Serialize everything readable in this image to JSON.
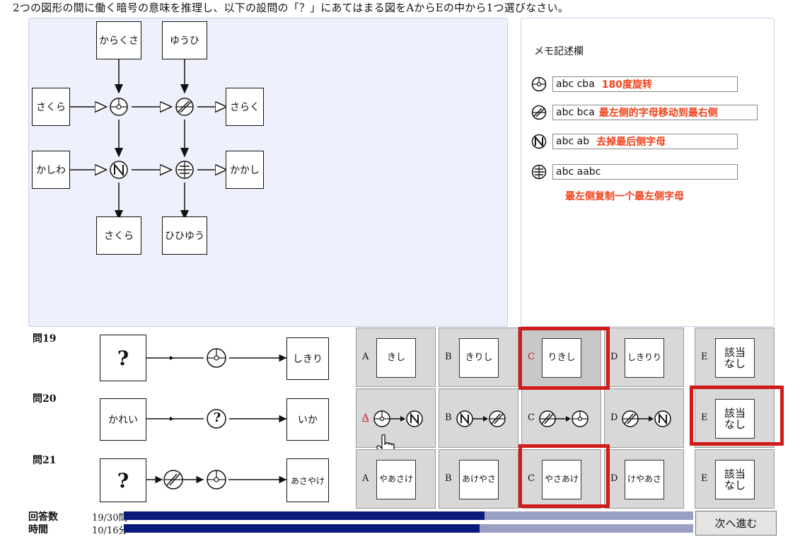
{
  "instruction": "2つの図形の間に働く暗号の意味を推理し、以下の設問の「？」にあてはまる図をAからEの中から1つ選びなさい。",
  "diagram": {
    "top_left": "からくさ",
    "top_right": "ゆうひ",
    "left_top": "さくら",
    "right_top": "さらく",
    "left_bottom": "かしわ",
    "right_bottom": "かかし",
    "bottom_left": "さくら",
    "bottom_right": "ひひゆう"
  },
  "memo": {
    "title": "メモ記述欄",
    "rows": [
      {
        "icon": "rotate-symbol-icon",
        "value": "abc  cba",
        "note": "180度旋转"
      },
      {
        "icon": "slash-symbol-icon",
        "value": "abc bca",
        "note": "最左侧的字母移动到最右侧"
      },
      {
        "icon": "n-symbol-icon",
        "value": "abc   ab",
        "note": "去掉最后侧字母"
      },
      {
        "icon": "divide-symbol-icon",
        "value": "abc  aabc",
        "note": ""
      }
    ],
    "note_below": "最左侧复制一个最左侧字母"
  },
  "questions": [
    {
      "label": "問19",
      "left": "?",
      "right": "しきり",
      "choices": [
        {
          "letter": "A",
          "text": "きし"
        },
        {
          "letter": "B",
          "text": "きりし"
        },
        {
          "letter": "C",
          "text": "りきし"
        },
        {
          "letter": "D",
          "text": "しきりり"
        },
        {
          "letter": "E",
          "text": "該当\nなし"
        }
      ]
    },
    {
      "label": "問20",
      "left": "かれい",
      "middle": "?",
      "right": "いか",
      "choices": [
        {
          "letter": "A"
        },
        {
          "letter": "B"
        },
        {
          "letter": "C"
        },
        {
          "letter": "D"
        },
        {
          "letter": "E",
          "text": "該当\nなし"
        }
      ]
    },
    {
      "label": "問21",
      "left": "?",
      "right": "あさやけ",
      "choices": [
        {
          "letter": "A",
          "text": "やあさけ"
        },
        {
          "letter": "B",
          "text": "あけやさ"
        },
        {
          "letter": "C",
          "text": "やさあけ"
        },
        {
          "letter": "D",
          "text": "けやあさ"
        },
        {
          "letter": "E",
          "text": "該当\nなし"
        }
      ]
    }
  ],
  "progress": {
    "answers_label": "回答数",
    "answers_value": "19/30問",
    "answers_fraction": 0.633,
    "time_label": "時間",
    "time_value": "10/16分",
    "time_fraction": 0.625
  },
  "next_label": "次へ進む",
  "colors": {
    "accent_red": "#d11b1b",
    "note_orange": "#f0401a",
    "bar_fill": "#0b1a7a",
    "bar_track": "#9aa0c4"
  }
}
